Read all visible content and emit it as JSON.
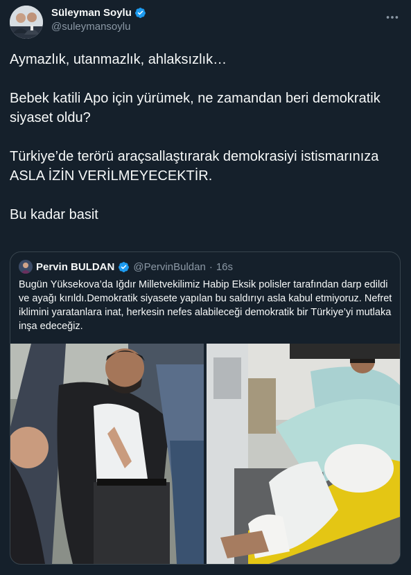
{
  "author": {
    "name": "Süleyman Soylu",
    "handle": "@suleymansoylu"
  },
  "tweet": {
    "text": "Aymazlık, utanmazlık, ahlaksızlık…\n\nBebek katili Apo için yürümek, ne zamandan beri demokratik siyaset oldu?\n\nTürkiye’de terörü araçsallaştırarak demokrasiyi istismarınıza\nASLA İZİN VERİLMEYECEKTİR.\n\nBu kadar basit"
  },
  "quoted": {
    "name": "Pervin BULDAN",
    "handle": "@PervinBuldan",
    "separator": "·",
    "time": "16s",
    "text": "Bugün Yüksekova’da Iğdır Milletvekilimiz Habip Eksik polisler tarafından darp edildi ve ayağı kırıldı.Demokratik siyasete yapılan bu saldırıyı asla kabul etmiyoruz. Nefret iklimini yaratanlara inat, herkesin nefes alabileceği demokratik bir Türkiye’yi mutlaka inşa edeceğiz."
  },
  "icons": {
    "verified": "verified-badge-icon",
    "more": "more-options-icon"
  },
  "colors": {
    "background": "#15202b",
    "text": "#f7f9f9",
    "secondary": "#8b98a5",
    "border": "#38444d",
    "verified": "#1d9bf0"
  }
}
